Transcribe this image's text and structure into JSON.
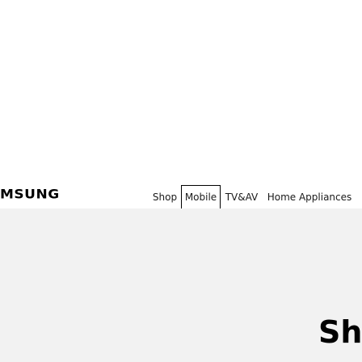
{
  "header": {
    "logo_text": "MSUNG",
    "nav": {
      "items": [
        {
          "label": "Shop"
        },
        {
          "label": "Mobile"
        },
        {
          "label": "TV&AV"
        },
        {
          "label": "Home Appliances"
        }
      ],
      "active_index": 1
    }
  },
  "hero": {
    "headline_partial": "Sh"
  },
  "colors": {
    "page_background": "#ffffff",
    "band_background": "#f2f2f2",
    "text": "#000000",
    "active_border": "#000000"
  }
}
